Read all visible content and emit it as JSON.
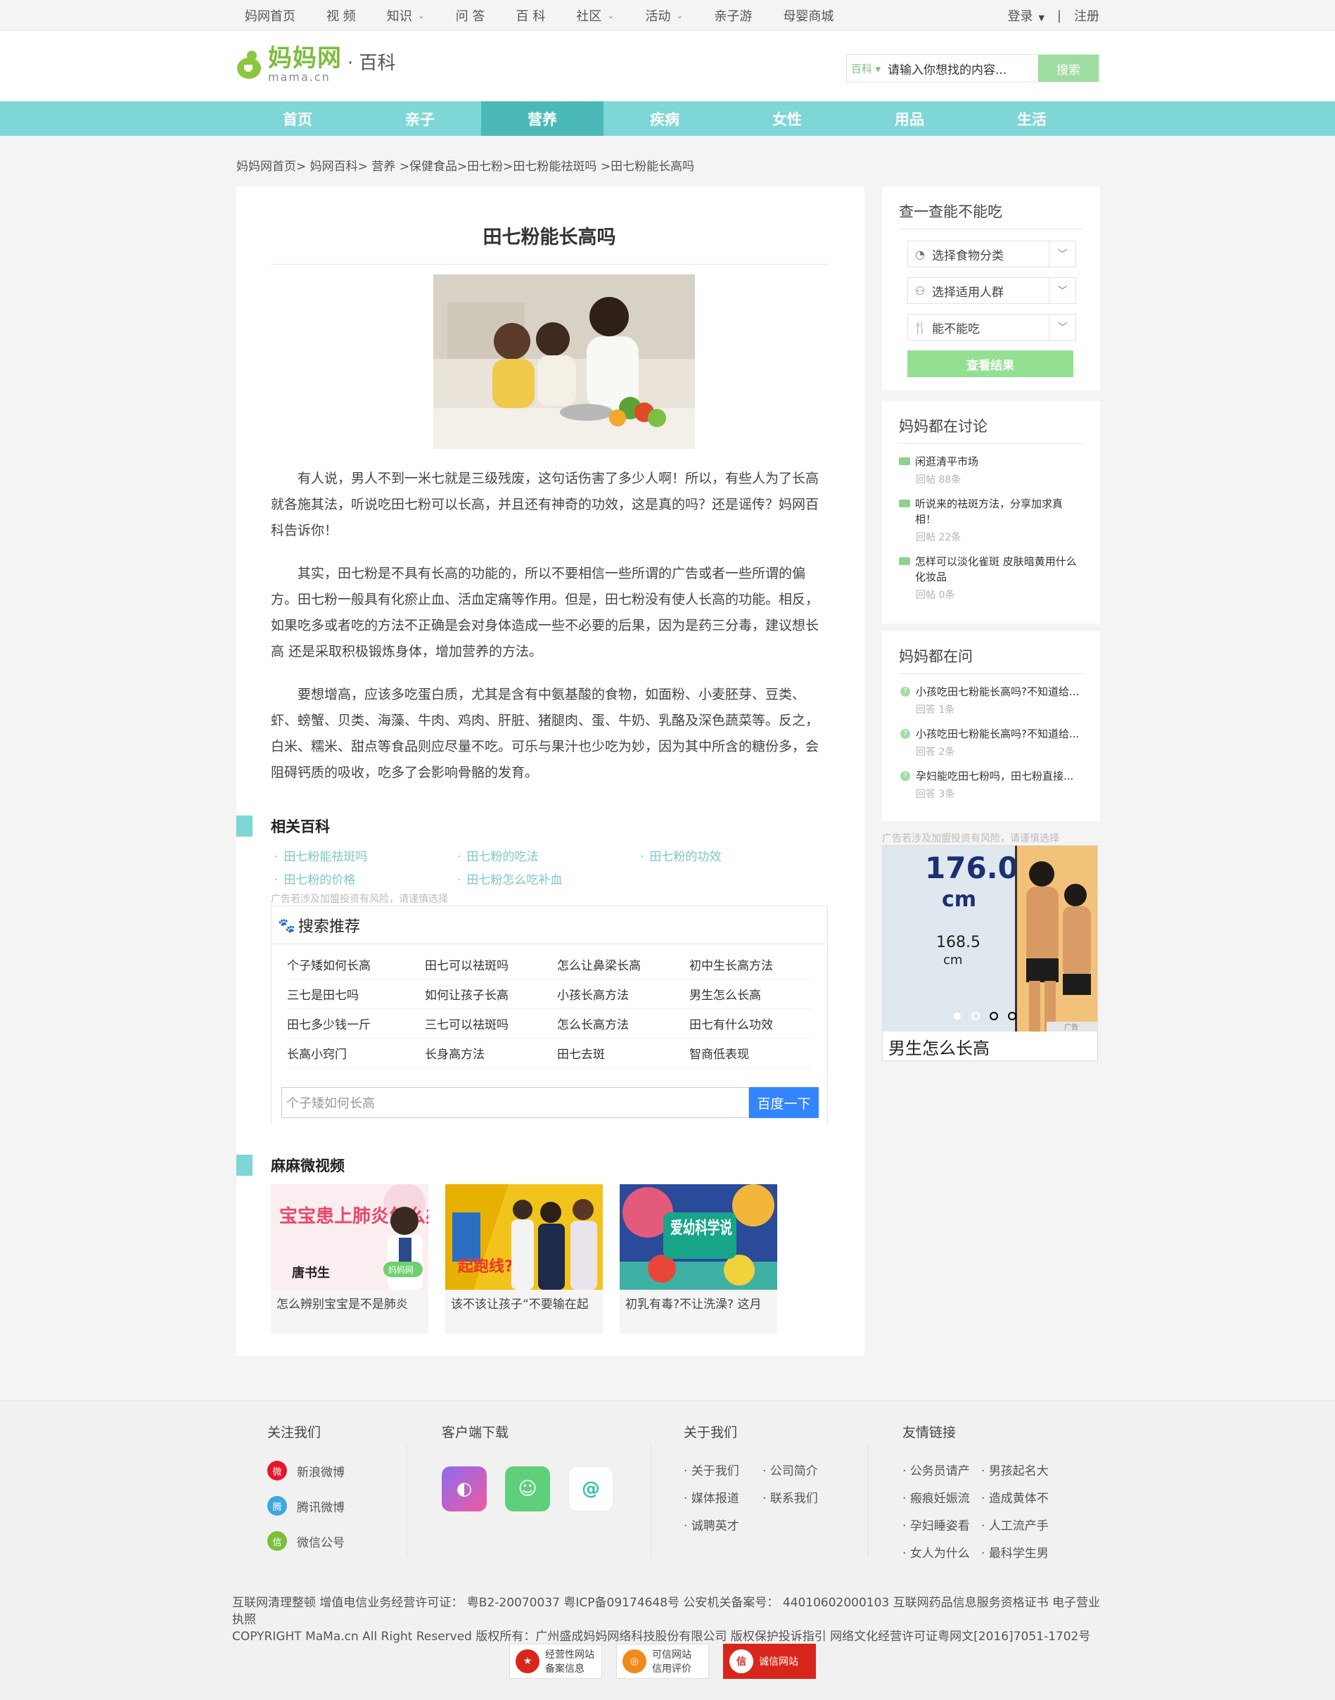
{
  "topnav": {
    "items": [
      {
        "label": "妈网首页",
        "dropdown": false
      },
      {
        "label": "视 频",
        "dropdown": false
      },
      {
        "label": "知识",
        "dropdown": true
      },
      {
        "label": "问 答",
        "dropdown": false
      },
      {
        "label": "百 科",
        "dropdown": false
      },
      {
        "label": "社区",
        "dropdown": true
      },
      {
        "label": "活动",
        "dropdown": true
      },
      {
        "label": "亲子游",
        "dropdown": false
      },
      {
        "label": "母婴商城",
        "dropdown": false
      }
    ],
    "login": "登录",
    "separator": "|",
    "register": "注册"
  },
  "header": {
    "logo_cn": "妈妈网",
    "logo_en": "mama.cn",
    "logo_sub": "· 百科",
    "search_scope": "百科 ▾",
    "search_placeholder": "请输入你想找的内容...",
    "search_button": "搜索"
  },
  "mainnav": {
    "items": [
      "首页",
      "亲子",
      "营养",
      "疾病",
      "女性",
      "用品",
      "生活"
    ],
    "active": "营养"
  },
  "breadcrumb": "妈妈网首页> 妈网百科> 营养 >保健食品>田七粉>田七粉能祛斑吗 >田七粉能长高吗",
  "article": {
    "title": "田七粉能长高吗",
    "paragraphs": [
      "有人说，男人不到一米七就是三级残废，这句话伤害了多少人啊！所以，有些人为了长高就各施其法，听说吃田七粉可以长高，并且还有神奇的功效，这是真的吗？还是谣传？妈网百科告诉你！",
      "其实，田七粉是不具有长高的功能的，所以不要相信一些所谓的广告或者一些所谓的偏方。田七粉一般具有化瘀止血、活血定痛等作用。但是，田七粉没有使人长高的功能。相反，如果吃多或者吃的方法不正确是会对身体造成一些不必要的后果，因为是药三分毒，建议想长高 还是采取积极锻炼身体，增加营养的方法。",
      "要想增高，应该多吃蛋白质，尤其是含有中氨基酸的食物，如面粉、小麦胚芽、豆类、虾、螃蟹、贝类、海藻、牛肉、鸡肉、肝脏、猪腿肉、蛋、牛奶、乳酪及深色蔬菜等。反之，白米、糯米、甜点等食品则应尽量不吃。可乐与果汁也少吃为妙，因为其中所含的糖份多，会阻碍钙质的吸收，吃多了会影响骨骼的发育。"
    ]
  },
  "related": {
    "title": "相关百科",
    "links": [
      "田七粉能祛斑吗",
      "田七粉的吃法",
      "田七粉的功效",
      "田七粉的价格",
      "田七粉怎么吃补血"
    ],
    "ad_note": "广告若涉及加盟投资有风险，请谨慎选择"
  },
  "recommend": {
    "title": "搜索推荐",
    "rows": [
      [
        "个子矮如何长高",
        "田七可以祛斑吗",
        "怎么让鼻梁长高",
        "初中生长高方法"
      ],
      [
        "三七是田七吗",
        "如何让孩子长高",
        "小孩长高方法",
        "男生怎么长高"
      ],
      [
        "田七多少钱一斤",
        "三七可以祛斑吗",
        "怎么长高方法",
        "田七有什么功效"
      ],
      [
        "长高小窍门",
        "长身高方法",
        "田七去斑",
        "智商低表现"
      ]
    ],
    "search_value": "个子矮如何长高",
    "search_button": "百度一下"
  },
  "videos": {
    "title": "麻麻微视频",
    "items": [
      {
        "caption": "怎么辨别宝宝是不是肺炎",
        "thumb_text": "宝宝患上肺炎怎么办?专家这样说",
        "thumb_name": "唐书生",
        "brand": "妈妈网"
      },
      {
        "caption": "该不该让孩子“不要输在起",
        "thumb_text": "起跑线?"
      },
      {
        "caption": "初乳有毒?不让洗澡? 这月",
        "thumb_text": "爱幼科学说"
      }
    ]
  },
  "sidebar": {
    "check": {
      "title": "查一查能不能吃",
      "selects": [
        "选择食物分类",
        "选择适用人群",
        "能不能吃"
      ],
      "button": "查看结果"
    },
    "discuss": {
      "title": "妈妈都在讨论",
      "items": [
        {
          "q": "闲逛清平市场",
          "stat": "回帖 88条"
        },
        {
          "q": "听说来的祛斑方法，分享加求真相！",
          "stat": "回帖 22条"
        },
        {
          "q": "怎样可以淡化雀斑 皮肤暗黄用什么化妆品",
          "stat": "回帖 0条"
        }
      ]
    },
    "ask": {
      "title": "妈妈都在问",
      "items": [
        {
          "q": "小孩吃田七粉能长高吗?不知道给...",
          "stat": "回答 1条"
        },
        {
          "q": "小孩吃田七粉能长高吗?不知道给...",
          "stat": "回答 2条"
        },
        {
          "q": "孕妇能吃田七粉吗，田七粉直接...",
          "stat": "回答 3条"
        }
      ]
    },
    "ad": {
      "note": "广告若涉及加盟投资有风险，请谨慎选择",
      "h1": "176.0",
      "u1": "cm",
      "h2": "168.5",
      "u2": "cm",
      "tag": "广告",
      "caption": "男生怎么长高"
    }
  },
  "footer": {
    "follow": {
      "title": "关注我们",
      "items": [
        "新浪微博",
        "腾讯微博",
        "微信公号"
      ]
    },
    "apps": {
      "title": "客户端下载"
    },
    "about": {
      "title": "关于我们",
      "links": [
        "关于我们",
        "公司简介",
        "媒体报道",
        "联系我们",
        "诚聘英才"
      ]
    },
    "friends": {
      "title": "友情链接",
      "links": [
        "公务员请产",
        "男孩起名大",
        "瘢痕妊娠流",
        "造成黄体不",
        "孕妇睡姿看",
        "人工流产手",
        "女人为什么",
        "最科学生男"
      ]
    },
    "line1": "互联网清理整顿 增值电信业务经营许可证： 粤B2-20070037 粤ICP备09174648号 公安机关备案号： 44010602000103 互联网药品信息服务资格证书 电子营业执照",
    "line2": "COPYRIGHT MaMa.cn All Right Reserved 版权所有：广州盛成妈妈网络科技股份有限公司 版权保护投诉指引 网络文化经营许可证粤网文[2016]7051-1702号",
    "badges": [
      {
        "l1": "经营性网站",
        "l2": "备案信息"
      },
      {
        "l1": "可信网站",
        "l2": "信用评价"
      },
      {
        "l1": "诚信网站",
        "l2": ""
      }
    ]
  }
}
